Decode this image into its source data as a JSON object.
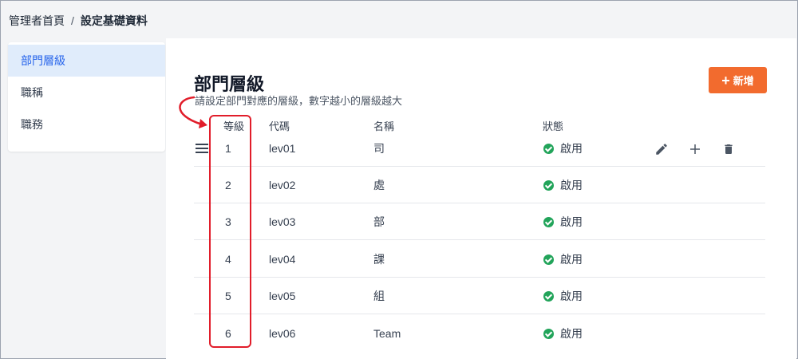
{
  "breadcrumb": {
    "home": "管理者首頁",
    "separator": "/",
    "current": "設定基礎資料"
  },
  "sidebar": {
    "items": [
      {
        "label": "部門層級",
        "active": true
      },
      {
        "label": "職稱",
        "active": false
      },
      {
        "label": "職務",
        "active": false
      }
    ]
  },
  "main": {
    "title": "部門層級",
    "subtitle": "請設定部門對應的層級，數字越小的層級越大",
    "add_button_label": "新增",
    "add_button_icon": "plus-icon"
  },
  "table": {
    "headers": {
      "level": "等級",
      "code": "代碼",
      "name": "名稱",
      "status": "狀態"
    },
    "rows": [
      {
        "level": "1",
        "code": "lev01",
        "name": "司",
        "status": "啟用"
      },
      {
        "level": "2",
        "code": "lev02",
        "name": "處",
        "status": "啟用"
      },
      {
        "level": "3",
        "code": "lev03",
        "name": "部",
        "status": "啟用"
      },
      {
        "level": "4",
        "code": "lev04",
        "name": "課",
        "status": "啟用"
      },
      {
        "level": "5",
        "code": "lev05",
        "name": "組",
        "status": "啟用"
      },
      {
        "level": "6",
        "code": "lev06",
        "name": "Team",
        "status": "啟用"
      }
    ],
    "row_actions": [
      "pencil-icon",
      "plus-icon",
      "trash-icon"
    ]
  },
  "colors": {
    "accent": "#f26b2e",
    "active_nav_bg": "#e0ecfb",
    "active_nav_text": "#2563eb",
    "status_green": "#22a45a",
    "annotation_red": "#e11d2a"
  }
}
